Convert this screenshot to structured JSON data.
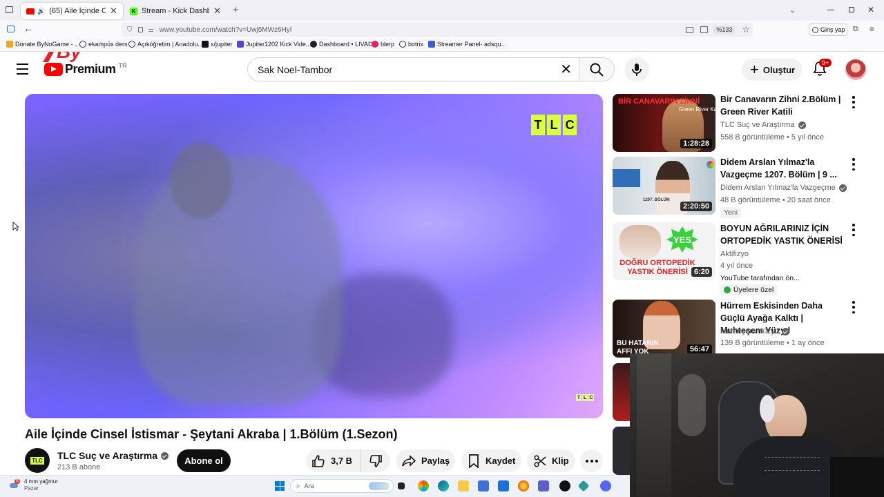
{
  "browser": {
    "tabs": [
      {
        "title": "(65) Aile İçinde Cinsel İstismar",
        "active": true
      },
      {
        "title": "Stream - Kick Dashboard",
        "active": false
      }
    ],
    "url": "www.youtube.com/watch?v=Uwj5MWz6HyI",
    "zoom": "%133",
    "signin_label": "Giriş yap",
    "bookmarks": [
      "Donate ByNoGame - ...",
      "ekampüs ders",
      "Açıköğretim | Anadolu...",
      "x/jupiter",
      "Jupiter1202 Kick Vide...",
      "Dashboard • LIVAD",
      "blerp",
      "botrix",
      "Streamer Panel- adsqu..."
    ]
  },
  "header": {
    "logo_text": "Premium",
    "logo_sup": "TR",
    "search_value": "Sak Noel-Tambor",
    "create_label": "Oluştur",
    "notif_badge": "9+"
  },
  "player": {
    "watermark": [
      "T",
      "L",
      "C"
    ]
  },
  "video": {
    "title": "Aile İçinde Cinsel İstismar - Şeytani Akraba | 1.Bölüm (1.Sezon)",
    "channel": "TLC Suç ve Araştırma",
    "channel_avatar_text": "TLC",
    "subscribers": "213 B abone",
    "subscribe_label": "Abone ol",
    "likes": "3,7 B",
    "share_label": "Paylaş",
    "save_label": "Kaydet",
    "clip_label": "Klip"
  },
  "related": [
    {
      "title": "Bir Canavarın Zihni 2.Bölüm | Green River Katili",
      "channel": "TLC Suç ve Araştırma",
      "meta": "558 B görüntüleme • 5 yıl önce",
      "duration": "1:28:28",
      "thumb_text": "BİR CANAVARIN ZİHNİ",
      "thumb_sub": "Green River Katili"
    },
    {
      "title": "Didem Arslan Yılmaz'la Vazgeçme 1207. Bölüm | 9 ...",
      "channel": "Didem Arslan Yılmaz'la Vazgeçme",
      "meta": "48 B görüntüleme • 20 saat önce",
      "duration": "2:20:50",
      "badge": "Yeni",
      "thumb_text": "1207. BÖLÜM"
    },
    {
      "title": "BOYUN AĞRILARINIZ İÇİN ORTOPEDİK YASTIK ÖNERİSİ",
      "channel": "Aktifizyo",
      "meta": "4 yıl önce",
      "extra": "YouTube tarafından ön...",
      "members": "Üyelere özel",
      "duration": "6:20",
      "thumb_text": "DOĞRU ORTOPEDİK YASTIK ÖNERİSİ",
      "thumb_yes": "YES"
    },
    {
      "title": "Hürrem Eskisinden Daha Güçlü Ayağa Kalktı | Muhteşem Yüzyıl",
      "channel": "Muhteşem Yüzyıl",
      "meta": "139 B görüntüleme • 1 ay önce",
      "duration": "56:47",
      "thumb_text": "BU HATANIN AFFI YOK"
    }
  ],
  "taskbar": {
    "weather": "4 mm yağmur",
    "weather_sub": "Pazar",
    "weather_badge": "8",
    "search_placeholder": "Ara"
  },
  "colors": {
    "yt_red": "#ff0000",
    "tlc_yellow": "#d9ff3f",
    "subscribe_bg": "#0f0f0f"
  }
}
